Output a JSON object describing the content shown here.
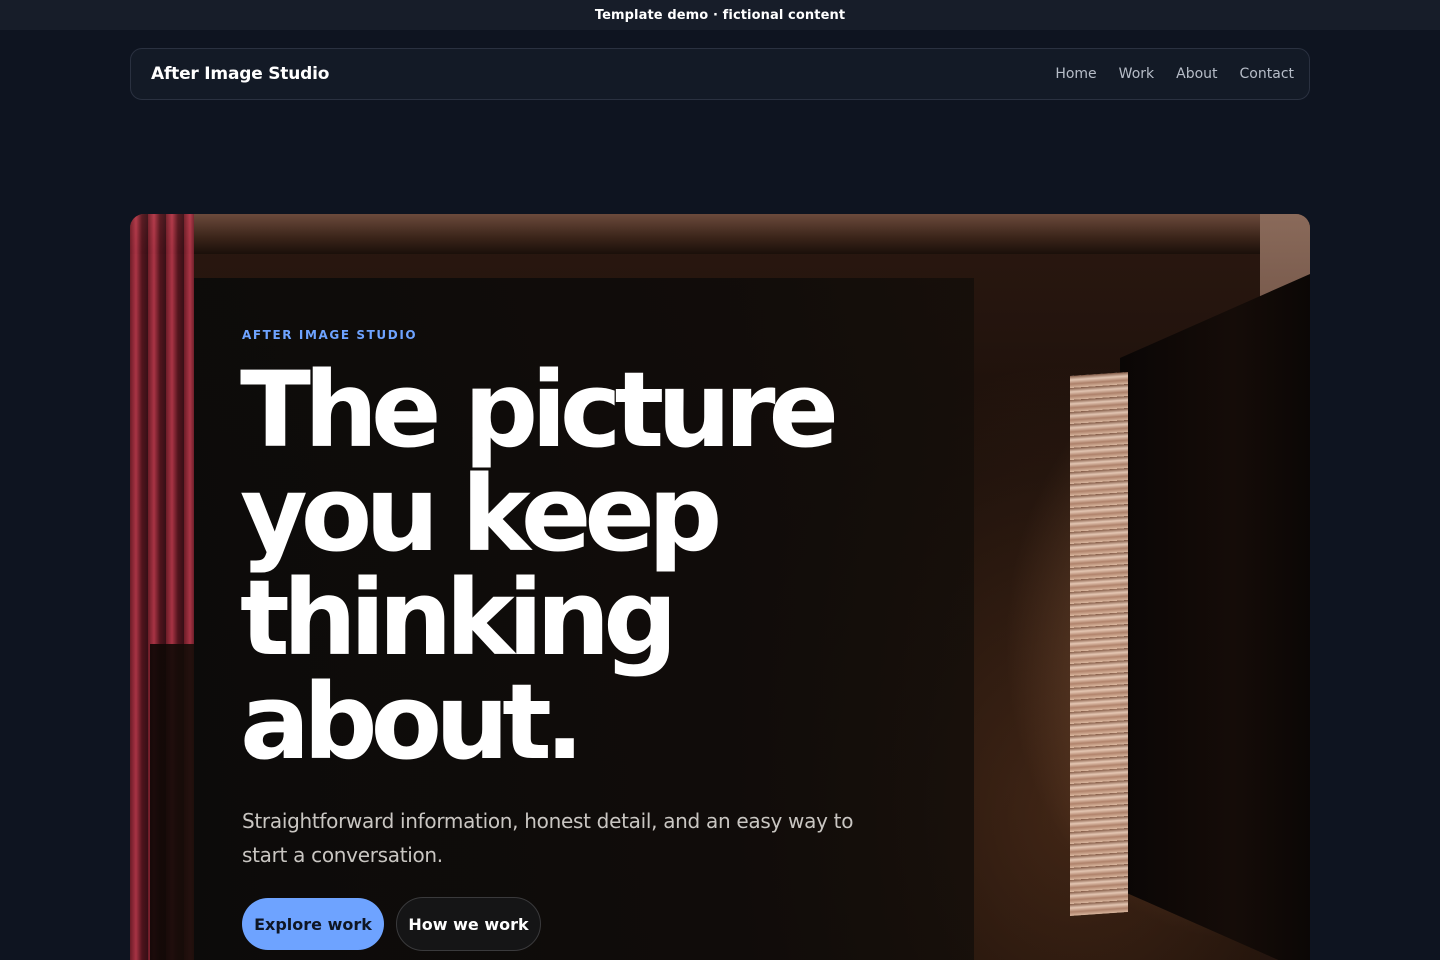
{
  "banner": {
    "text": "Template demo · fictional content"
  },
  "nav": {
    "brand": "After Image Studio",
    "links": [
      "Home",
      "Work",
      "About",
      "Contact"
    ]
  },
  "hero": {
    "eyebrow": "AFTER IMAGE STUDIO",
    "headline_lines": [
      "The picture",
      "you keep",
      "thinking",
      "about."
    ],
    "subtext": "Straightforward information, honest detail, and an easy way to start a conversation.",
    "primary_button": "Explore work",
    "secondary_button": "How we work"
  },
  "colors": {
    "accent": "#6ea3ff",
    "page_background": "#0e1420",
    "nav_background": "#131a26"
  }
}
